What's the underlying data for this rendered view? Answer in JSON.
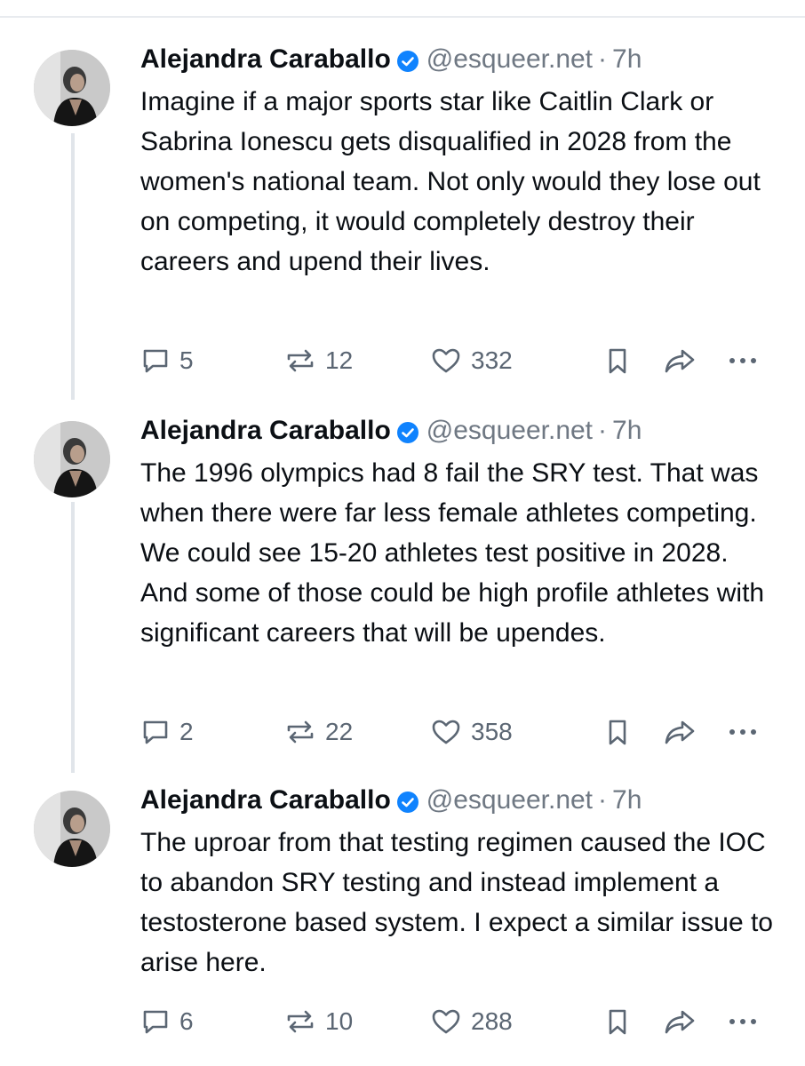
{
  "posts": [
    {
      "author": "Alejandra Caraballo",
      "handle": "@esqueer.net",
      "separator": "·",
      "time": "7h",
      "text": "Imagine if a major sports star like Caitlin Clark or Sabrina Ionescu gets disqualified in 2028 from the women's national team. Not only would they lose out on competing, it would completely destroy their careers and upend their lives.",
      "replies": "5",
      "reposts": "12",
      "likes": "332"
    },
    {
      "author": "Alejandra Caraballo",
      "handle": "@esqueer.net",
      "separator": "·",
      "time": "7h",
      "text": "The 1996 olympics had 8 fail the SRY test. That was when there were far less female athletes competing. We could see 15-20 athletes test positive in 2028. And some of those could be high profile athletes with significant careers that will be upendes.",
      "replies": "2",
      "reposts": "22",
      "likes": "358"
    },
    {
      "author": "Alejandra Caraballo",
      "handle": "@esqueer.net",
      "separator": "·",
      "time": "7h",
      "text": "The uproar from that testing regimen caused the IOC to abandon SRY testing and instead implement a testosterone based system. I expect a similar issue to arise here.",
      "replies": "6",
      "reposts": "10",
      "likes": "288"
    }
  ],
  "icons": {
    "reply": "speech-bubble-icon",
    "repost": "repost-arrows-icon",
    "like": "heart-icon",
    "bookmark": "bookmark-icon",
    "share": "share-arrow-icon",
    "more": "more-dots-icon",
    "verified": "verified-badge-icon"
  },
  "colors": {
    "verified": "#1083fe",
    "muted": "#6f7883",
    "action": "#5b6673",
    "thread_line": "#e1e5ea"
  }
}
